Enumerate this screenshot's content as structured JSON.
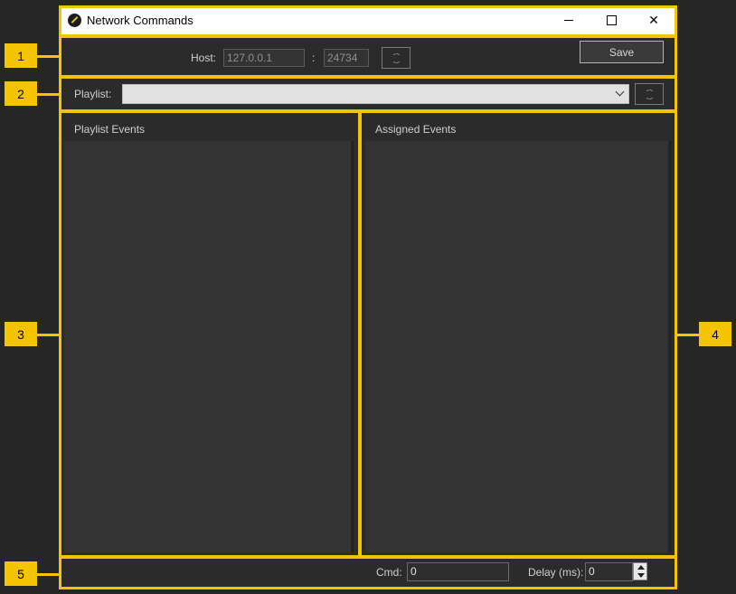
{
  "window": {
    "title": "Network Commands"
  },
  "host": {
    "label": "Host:",
    "ip": "127.0.0.1",
    "separator": ":",
    "port": "24734"
  },
  "toolbar": {
    "save_label": "Save"
  },
  "playlist": {
    "label": "Playlist:",
    "selected": ""
  },
  "panes": {
    "playlist_events": "Playlist Events",
    "assigned_events": "Assigned Events"
  },
  "footer": {
    "cmd_label": "Cmd:",
    "cmd_value": "0",
    "delay_label": "Delay (ms):",
    "delay_value": "0"
  },
  "callouts": [
    "1",
    "2",
    "3",
    "4",
    "5"
  ],
  "colors": {
    "highlight": "#f5c400",
    "background": "#262626",
    "panel": "#2b2b2b",
    "list": "#333333"
  },
  "icons": {
    "app": "app-logo-icon",
    "refresh": "refresh-icon",
    "dropdown": "chevron-down-icon"
  }
}
